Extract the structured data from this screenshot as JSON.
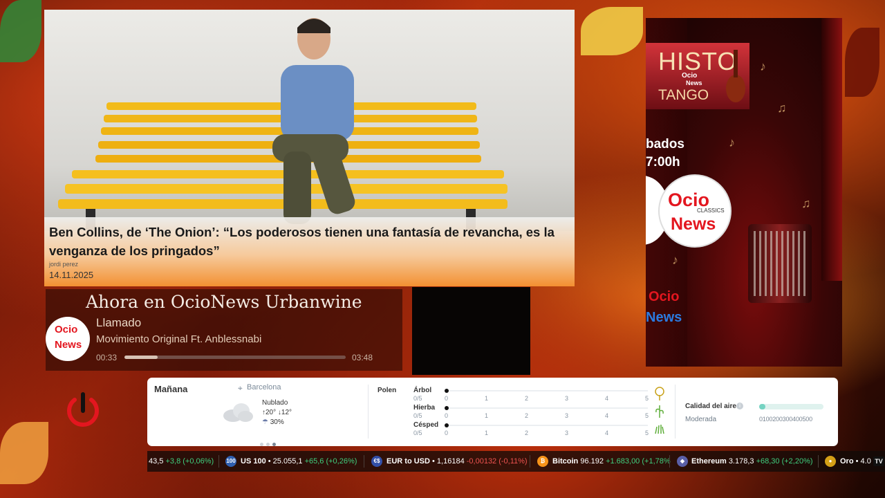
{
  "news": {
    "title": "Ben Collins, de ‘The Onion’: “Los poderosos tienen una fantasía de revancha, es la venganza de los pringados”",
    "author": "jordi perez",
    "date": "14.11.2025"
  },
  "player": {
    "heading": "Ahora en OcioNews Urbanwine",
    "logo": {
      "word1": "Ocio",
      "word2": "News"
    },
    "track_title": "Llamado",
    "track_artist": "Movimiento Original Ft. Anblessnabi",
    "time_current": "00:33",
    "time_duration": "03:48",
    "progress_fraction": 0.15
  },
  "promo": {
    "histo_top": "HISTO",
    "histo_bottom": "TANGO",
    "histo_brand_1": "Ocio",
    "histo_brand_2": "News",
    "days": "bados",
    "time": "7:00h",
    "logo_word1": "Ocio",
    "logo_classics": "CLASSICS",
    "logo_word2": "News",
    "bottom_word1": "Ocio",
    "bottom_word2": "News"
  },
  "weather": {
    "day": "Mañana",
    "city": "Barcelona",
    "condition": "Nublado",
    "temp_high": "20°",
    "temp_low": "12°",
    "rain": "30%",
    "icon": "cloud-icon"
  },
  "pollen": {
    "label": "Polen",
    "ticks": [
      "0",
      "1",
      "2",
      "3",
      "4",
      "5"
    ],
    "rows": [
      {
        "name": "Árbol",
        "score": "0/5",
        "value": 0,
        "icon": "tree-pollen-icon"
      },
      {
        "name": "Hierba",
        "score": "0/5",
        "value": 0,
        "icon": "herb-pollen-icon"
      },
      {
        "name": "Césped",
        "score": "0/5",
        "value": 0,
        "icon": "grass-pollen-icon"
      }
    ]
  },
  "air_quality": {
    "label": "Calidad del aire",
    "value": "Moderada",
    "scale": "0100200300400500",
    "accent": "#75d3c2"
  },
  "ticker": [
    {
      "name": "",
      "price": "43,5",
      "change": "+3,8 (+0,06%)",
      "direction": "up"
    },
    {
      "badge": "100",
      "name": "US 100",
      "price": "25.055,1",
      "change": "+65,6 (+0,26%)",
      "direction": "up"
    },
    {
      "badge": "€$",
      "name": "EUR to USD",
      "price": "1,16184",
      "change": "-0,00132 (-0,11%)",
      "direction": "down"
    },
    {
      "badge": "₿",
      "name": "Bitcoin",
      "price": "96.192",
      "change": "+1.683,00 (+1,78%",
      "direction": "up"
    },
    {
      "badge": "◆",
      "name": "Ethereum",
      "price": "3.178,3",
      "change": "+68,30 (+2,20%)",
      "direction": "up"
    },
    {
      "badge": "●",
      "name": "Oro",
      "price": "4.0",
      "change": "",
      "direction": "up"
    }
  ],
  "ticker_logo": "TV",
  "colors": {
    "up": "#3fcf7f",
    "down": "#ef5350",
    "ocio_red": "#e3161f",
    "brand_orange": "#f48c28"
  }
}
